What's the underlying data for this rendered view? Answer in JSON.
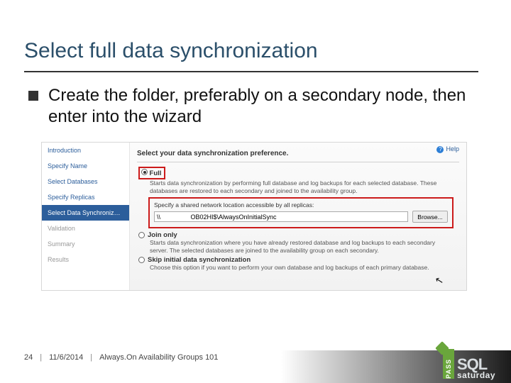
{
  "title": "Select full data synchronization",
  "bullet": "Create the folder, preferably on a secondary node, then enter into the wizard",
  "wizard": {
    "help": "Help",
    "steps": {
      "s0": "Introduction",
      "s1": "Specify Name",
      "s2": "Select Databases",
      "s3": "Specify Replicas",
      "s4": "Select Data Synchronization",
      "s5": "Validation",
      "s6": "Summary",
      "s7": "Results"
    },
    "heading": "Select your data synchronization preference.",
    "opt_full": {
      "label": "Full",
      "desc": "Starts data synchronization by performing full database and log backups for each selected database. These databases are restored to each secondary and joined to the availability group.",
      "net_label": "Specify a shared network location accessible by all replicas:",
      "net_value": "\\\\                 OB02HI$\\AlwaysOnInitialSync",
      "browse": "Browse..."
    },
    "opt_join": {
      "label": "Join only",
      "desc": "Starts data synchronization where you have already restored database and log backups to each secondary server. The selected databases are joined to the availability group on each secondary."
    },
    "opt_skip": {
      "label": "Skip initial data synchronization",
      "desc": "Choose this option if you want to perform your own database and log backups of each primary database."
    }
  },
  "footer": {
    "page": "24",
    "date": "11/6/2014",
    "deck": "Always.On Availability Groups 101"
  },
  "logo": {
    "pass": "PASS",
    "sql": "SQL",
    "sat": "saturday"
  }
}
